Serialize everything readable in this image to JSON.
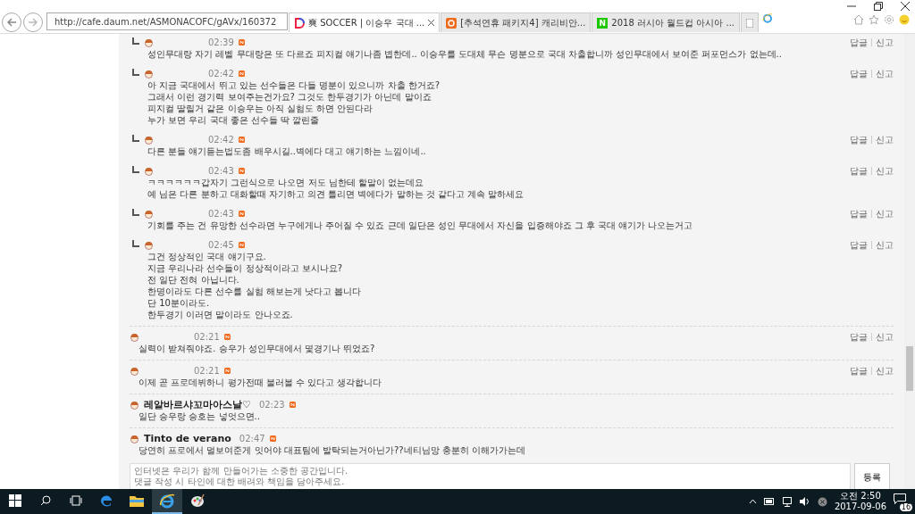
{
  "browser": {
    "address": "http://cafe.daum.net/ASMONACOFC/gAVx/160372",
    "tabs": [
      {
        "label": "爽 SOCCER | 이승우 국대 ...",
        "selected": true
      },
      {
        "label": "[추석연휴 패키지4] 캐리비안...",
        "selected": false
      },
      {
        "label": "2018 러시아 월드컵 아시아 ...",
        "selected": false,
        "icon_text": "N"
      }
    ]
  },
  "comments": [
    {
      "kind": "reply",
      "time": "02:39",
      "new": true,
      "lines": [
        "성인무대랑 자기 레벨 무대랑은 또 다르죠 피지컬 얘기나좀 볍한데.. 이승우를 도대체 무슨 명분으로 국대 차출합니까 성인무대에서 보여준 퍼포먼스가 없는데.."
      ],
      "actions": [
        "답글",
        "신고"
      ]
    },
    {
      "kind": "reply",
      "time": "02:42",
      "new": true,
      "lines": [
        "아 지금 국대에서 뛰고 있는 선수들은 다들 명분이 있으니까 차출 한거죠?",
        "그래서 이런 경기력 보여주는건가요? 그것도 한두경기가 아닌데 말이죠",
        "피지컬 딸릴거 같은 이승우는 아직 실험도 하면 안된다라",
        "누가 보면 우리 국대 좋은 선수들 딱 깔린줄"
      ],
      "actions": [
        "답글",
        "신고"
      ]
    },
    {
      "kind": "reply",
      "time": "02:42",
      "new": true,
      "lines": [
        "다른 분들 얘기듣는법도좀 배우시길..벽에다 대고 얘기하는 느낌이네.."
      ],
      "actions": [
        "답글",
        "신고"
      ]
    },
    {
      "kind": "reply",
      "time": "02:43",
      "new": true,
      "lines": [
        "ㅋㅋㅋㅋㅋㅋ갑자기 그런식으로 나오면 저도 님한테 할말이 없는데요",
        "예 님은 다른 분하고 대화할때 자기하고 의견 틀리면 벽에다가 말하는 것 같다고 계속 말하세요"
      ],
      "actions": [
        "답글",
        "신고"
      ]
    },
    {
      "kind": "reply",
      "time": "02:43",
      "new": true,
      "lines": [
        "기회를 주는 건 유망한 선수라면 누구에게나 주어질 수 있죠 근데 일단은 성인 무대에서 자신을 입증해야죠 그 후 국대 얘기가 나오는거고"
      ],
      "actions": [
        "답글",
        "신고"
      ]
    },
    {
      "kind": "reply",
      "time": "02:45",
      "new": true,
      "lines": [
        "그건 정상적인 국대 얘기구요.",
        "지금 우리나라 선수들이 정상적이라고 보시나요?",
        "전 일단 전혀 아닙니다.",
        "한명이라도 다른 선수를 실험 해보는게 낫다고 봅니다",
        "단 10분이라도.",
        "한두경기 이러면 말이라도 안나오죠."
      ],
      "actions": [
        "답글",
        "신고"
      ]
    },
    {
      "kind": "comment",
      "time": "02:21",
      "new": true,
      "lines": [
        "실력이 받쳐줘야죠. 승우가 성인무대에서 몇경기나 뛰었죠?"
      ],
      "actions": [
        "답글",
        "신고"
      ]
    },
    {
      "kind": "comment",
      "time": "02:21",
      "new": true,
      "lines": [
        "이제 곧 프로데뷔하니 평가전때 불러볼 수 있다고 생각합니다"
      ],
      "actions": [
        "답글",
        "신고"
      ]
    },
    {
      "kind": "comment",
      "author": "레알바르샤꼬마아스날♡",
      "time": "02:23",
      "new": true,
      "lines": [
        "일단 승우랑 승호는 넣엇으면.."
      ]
    },
    {
      "kind": "comment",
      "author": "Tinto de verano",
      "time": "02:47",
      "new": true,
      "lines": [
        "당연히 프로에서 멀보여준게 잇어야 대표팀에 발탁되는거아닌가??네티님망 충분히 이해가가는데"
      ]
    }
  ],
  "comment_box": {
    "placeholder": "인터넷은 우리가 함께 만들어가는 소중한 공간입니다.\n댓글 작성 시 타인에 대한 배려와 책임을 담아주세요.",
    "submit": "등록"
  },
  "taskbar": {
    "apps": [
      {
        "kind": "edge",
        "active": false
      },
      {
        "kind": "explorer",
        "active": false
      },
      {
        "kind": "ie",
        "active": true
      },
      {
        "kind": "paint",
        "active": false
      }
    ],
    "time": "오전 2:50",
    "date": "2017-09-06",
    "notifications": "16"
  }
}
